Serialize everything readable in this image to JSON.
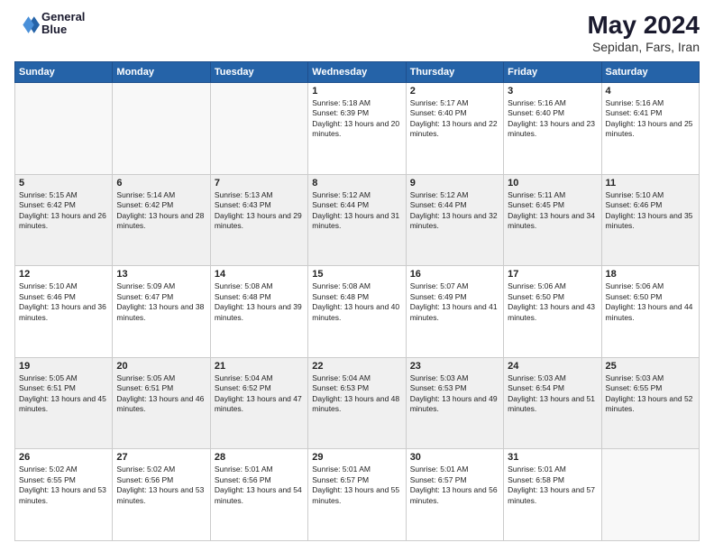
{
  "header": {
    "logo_line1": "General",
    "logo_line2": "Blue",
    "month": "May 2024",
    "location": "Sepidan, Fars, Iran"
  },
  "weekdays": [
    "Sunday",
    "Monday",
    "Tuesday",
    "Wednesday",
    "Thursday",
    "Friday",
    "Saturday"
  ],
  "rows": [
    [
      {
        "day": "",
        "sunrise": "",
        "sunset": "",
        "daylight": ""
      },
      {
        "day": "",
        "sunrise": "",
        "sunset": "",
        "daylight": ""
      },
      {
        "day": "",
        "sunrise": "",
        "sunset": "",
        "daylight": ""
      },
      {
        "day": "1",
        "sunrise": "Sunrise: 5:18 AM",
        "sunset": "Sunset: 6:39 PM",
        "daylight": "Daylight: 13 hours and 20 minutes."
      },
      {
        "day": "2",
        "sunrise": "Sunrise: 5:17 AM",
        "sunset": "Sunset: 6:40 PM",
        "daylight": "Daylight: 13 hours and 22 minutes."
      },
      {
        "day": "3",
        "sunrise": "Sunrise: 5:16 AM",
        "sunset": "Sunset: 6:40 PM",
        "daylight": "Daylight: 13 hours and 23 minutes."
      },
      {
        "day": "4",
        "sunrise": "Sunrise: 5:16 AM",
        "sunset": "Sunset: 6:41 PM",
        "daylight": "Daylight: 13 hours and 25 minutes."
      }
    ],
    [
      {
        "day": "5",
        "sunrise": "Sunrise: 5:15 AM",
        "sunset": "Sunset: 6:42 PM",
        "daylight": "Daylight: 13 hours and 26 minutes."
      },
      {
        "day": "6",
        "sunrise": "Sunrise: 5:14 AM",
        "sunset": "Sunset: 6:42 PM",
        "daylight": "Daylight: 13 hours and 28 minutes."
      },
      {
        "day": "7",
        "sunrise": "Sunrise: 5:13 AM",
        "sunset": "Sunset: 6:43 PM",
        "daylight": "Daylight: 13 hours and 29 minutes."
      },
      {
        "day": "8",
        "sunrise": "Sunrise: 5:12 AM",
        "sunset": "Sunset: 6:44 PM",
        "daylight": "Daylight: 13 hours and 31 minutes."
      },
      {
        "day": "9",
        "sunrise": "Sunrise: 5:12 AM",
        "sunset": "Sunset: 6:44 PM",
        "daylight": "Daylight: 13 hours and 32 minutes."
      },
      {
        "day": "10",
        "sunrise": "Sunrise: 5:11 AM",
        "sunset": "Sunset: 6:45 PM",
        "daylight": "Daylight: 13 hours and 34 minutes."
      },
      {
        "day": "11",
        "sunrise": "Sunrise: 5:10 AM",
        "sunset": "Sunset: 6:46 PM",
        "daylight": "Daylight: 13 hours and 35 minutes."
      }
    ],
    [
      {
        "day": "12",
        "sunrise": "Sunrise: 5:10 AM",
        "sunset": "Sunset: 6:46 PM",
        "daylight": "Daylight: 13 hours and 36 minutes."
      },
      {
        "day": "13",
        "sunrise": "Sunrise: 5:09 AM",
        "sunset": "Sunset: 6:47 PM",
        "daylight": "Daylight: 13 hours and 38 minutes."
      },
      {
        "day": "14",
        "sunrise": "Sunrise: 5:08 AM",
        "sunset": "Sunset: 6:48 PM",
        "daylight": "Daylight: 13 hours and 39 minutes."
      },
      {
        "day": "15",
        "sunrise": "Sunrise: 5:08 AM",
        "sunset": "Sunset: 6:48 PM",
        "daylight": "Daylight: 13 hours and 40 minutes."
      },
      {
        "day": "16",
        "sunrise": "Sunrise: 5:07 AM",
        "sunset": "Sunset: 6:49 PM",
        "daylight": "Daylight: 13 hours and 41 minutes."
      },
      {
        "day": "17",
        "sunrise": "Sunrise: 5:06 AM",
        "sunset": "Sunset: 6:50 PM",
        "daylight": "Daylight: 13 hours and 43 minutes."
      },
      {
        "day": "18",
        "sunrise": "Sunrise: 5:06 AM",
        "sunset": "Sunset: 6:50 PM",
        "daylight": "Daylight: 13 hours and 44 minutes."
      }
    ],
    [
      {
        "day": "19",
        "sunrise": "Sunrise: 5:05 AM",
        "sunset": "Sunset: 6:51 PM",
        "daylight": "Daylight: 13 hours and 45 minutes."
      },
      {
        "day": "20",
        "sunrise": "Sunrise: 5:05 AM",
        "sunset": "Sunset: 6:51 PM",
        "daylight": "Daylight: 13 hours and 46 minutes."
      },
      {
        "day": "21",
        "sunrise": "Sunrise: 5:04 AM",
        "sunset": "Sunset: 6:52 PM",
        "daylight": "Daylight: 13 hours and 47 minutes."
      },
      {
        "day": "22",
        "sunrise": "Sunrise: 5:04 AM",
        "sunset": "Sunset: 6:53 PM",
        "daylight": "Daylight: 13 hours and 48 minutes."
      },
      {
        "day": "23",
        "sunrise": "Sunrise: 5:03 AM",
        "sunset": "Sunset: 6:53 PM",
        "daylight": "Daylight: 13 hours and 49 minutes."
      },
      {
        "day": "24",
        "sunrise": "Sunrise: 5:03 AM",
        "sunset": "Sunset: 6:54 PM",
        "daylight": "Daylight: 13 hours and 51 minutes."
      },
      {
        "day": "25",
        "sunrise": "Sunrise: 5:03 AM",
        "sunset": "Sunset: 6:55 PM",
        "daylight": "Daylight: 13 hours and 52 minutes."
      }
    ],
    [
      {
        "day": "26",
        "sunrise": "Sunrise: 5:02 AM",
        "sunset": "Sunset: 6:55 PM",
        "daylight": "Daylight: 13 hours and 53 minutes."
      },
      {
        "day": "27",
        "sunrise": "Sunrise: 5:02 AM",
        "sunset": "Sunset: 6:56 PM",
        "daylight": "Daylight: 13 hours and 53 minutes."
      },
      {
        "day": "28",
        "sunrise": "Sunrise: 5:01 AM",
        "sunset": "Sunset: 6:56 PM",
        "daylight": "Daylight: 13 hours and 54 minutes."
      },
      {
        "day": "29",
        "sunrise": "Sunrise: 5:01 AM",
        "sunset": "Sunset: 6:57 PM",
        "daylight": "Daylight: 13 hours and 55 minutes."
      },
      {
        "day": "30",
        "sunrise": "Sunrise: 5:01 AM",
        "sunset": "Sunset: 6:57 PM",
        "daylight": "Daylight: 13 hours and 56 minutes."
      },
      {
        "day": "31",
        "sunrise": "Sunrise: 5:01 AM",
        "sunset": "Sunset: 6:58 PM",
        "daylight": "Daylight: 13 hours and 57 minutes."
      },
      {
        "day": "",
        "sunrise": "",
        "sunset": "",
        "daylight": ""
      }
    ]
  ]
}
